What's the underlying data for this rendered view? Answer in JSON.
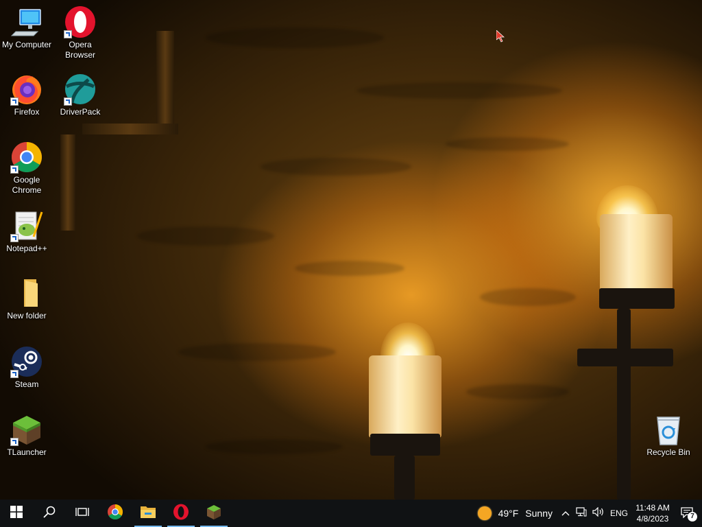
{
  "desktop": {
    "icons": [
      {
        "label": "My Computer",
        "icon": "computer-icon"
      },
      {
        "label": "Opera\nBrowser",
        "icon": "opera-icon"
      },
      {
        "label": "Firefox",
        "icon": "firefox-icon"
      },
      {
        "label": "DriverPack",
        "icon": "driverpack-icon"
      },
      {
        "label": "Google\nChrome",
        "icon": "chrome-icon"
      },
      {
        "label": "Notepad++",
        "icon": "notepadplusplus-icon"
      },
      {
        "label": "New folder",
        "icon": "folder-icon"
      },
      {
        "label": "Steam",
        "icon": "steam-icon"
      },
      {
        "label": "TLauncher",
        "icon": "minecraft-grass-icon"
      },
      {
        "label": "Recycle Bin",
        "icon": "recycle-bin-icon"
      }
    ]
  },
  "taskbar": {
    "start_icon": "windows-start-icon",
    "search_icon": "search-icon",
    "task_view_icon": "task-view-icon",
    "pinned": [
      {
        "icon": "chrome-icon",
        "active": false
      },
      {
        "icon": "file-explorer-icon",
        "active": true
      },
      {
        "icon": "opera-icon",
        "active": true
      },
      {
        "icon": "minecraft-grass-icon",
        "active": true
      }
    ],
    "weather": {
      "temperature": "49°F",
      "condition": "Sunny",
      "icon": "sun-icon"
    },
    "tray": {
      "chevron_icon": "chevron-up-icon",
      "network_icon": "network-icon",
      "volume_icon": "volume-icon",
      "language": "ENG"
    },
    "clock": {
      "time": "11:48 AM",
      "date": "4/8/2023"
    },
    "notifications": {
      "count": "7",
      "icon": "action-center-icon"
    }
  },
  "colors": {
    "taskbar_bg": "#101214",
    "active_indicator": "#76b9ed",
    "weather_sun": "#f5a623"
  }
}
